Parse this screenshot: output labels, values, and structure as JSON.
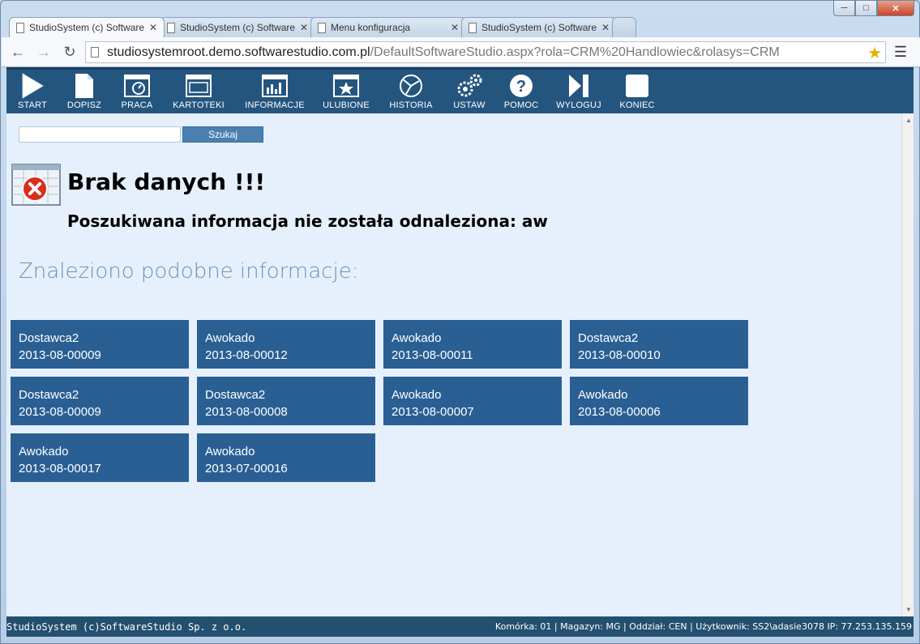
{
  "browser": {
    "tabs": [
      {
        "title": "StudioSystem (c) Software",
        "active": true
      },
      {
        "title": "StudioSystem (c) Software",
        "active": false
      },
      {
        "title": "Menu konfiguracja",
        "active": false
      },
      {
        "title": "StudioSystem (c) Software",
        "active": false
      }
    ],
    "url_host": "studiosystemroot.demo.softwarestudio.com.pl",
    "url_path": "/DefaultSoftwareStudio.aspx?rola=CRM%20Handlowiec&rolasys=CRM"
  },
  "menu": [
    {
      "label": "START",
      "icon": "play-icon"
    },
    {
      "label": "DOPISZ",
      "icon": "new-document-icon"
    },
    {
      "label": "PRACA",
      "icon": "clock-window-icon"
    },
    {
      "label": "KARTOTEKI",
      "icon": "window-icon"
    },
    {
      "label": "INFORMACJE",
      "icon": "bar-chart-icon"
    },
    {
      "label": "ULUBIONE",
      "icon": "star-window-icon"
    },
    {
      "label": "HISTORIA",
      "icon": "history-icon"
    },
    {
      "label": "USTAW",
      "icon": "gears-icon"
    },
    {
      "label": "POMOC",
      "icon": "help-icon"
    },
    {
      "label": "WYLOGUJ",
      "icon": "logout-icon"
    },
    {
      "label": "KONIEC",
      "icon": "square-icon"
    }
  ],
  "search": {
    "value": "",
    "button_label": "Szukaj"
  },
  "result": {
    "title": "Brak danych !!!",
    "message": "Poszukiwana informacja nie została odnaleziona: aw",
    "similar_heading": "Znaleziono podobne informacje:"
  },
  "tiles": [
    {
      "name": "Dostawca2",
      "code": "2013-08-00009"
    },
    {
      "name": "Awokado",
      "code": "2013-08-00012"
    },
    {
      "name": "Awokado",
      "code": "2013-08-00011"
    },
    {
      "name": "Dostawca2",
      "code": "2013-08-00010"
    },
    {
      "name": "Dostawca2",
      "code": "2013-08-00009"
    },
    {
      "name": "Dostawca2",
      "code": "2013-08-00008"
    },
    {
      "name": "Awokado",
      "code": "2013-08-00007"
    },
    {
      "name": "Awokado",
      "code": "2013-08-00006"
    },
    {
      "name": "Awokado",
      "code": "2013-08-00017"
    },
    {
      "name": "Awokado",
      "code": "2013-07-00016"
    }
  ],
  "status": {
    "left": "StudioSystem (c)SoftwareStudio Sp. z o.o.",
    "right": "Komórka: 01 | Magazyn: MG | Oddział: CEN | Użytkownik: SS2\\adasie3078 IP: 77.253.135.159"
  },
  "colors": {
    "menubar": "#24557f",
    "tile": "#2a5f94",
    "page_bg": "#e6f0fc",
    "heading": "#6f92b3"
  }
}
